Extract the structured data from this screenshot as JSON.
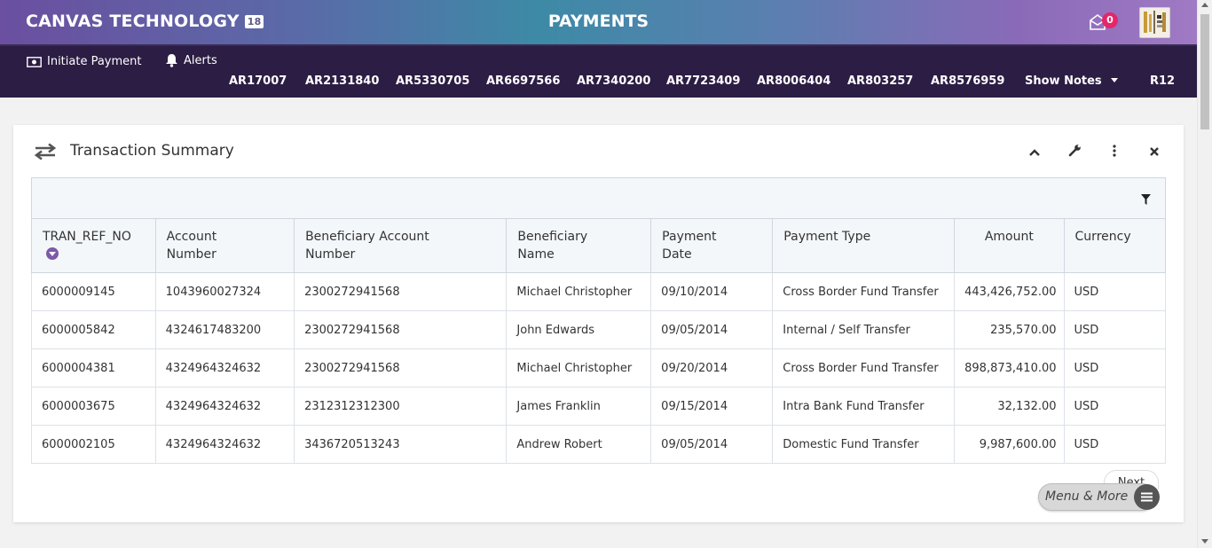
{
  "header": {
    "brand": "CANVAS TECHNOLOGY",
    "brand_badge": "18",
    "page_title": "PAYMENTS",
    "mail_count": "0"
  },
  "nav": {
    "initiate_payment": "Initiate Payment",
    "alerts": "Alerts",
    "links": [
      "AR17007",
      "AR2131840",
      "AR5330705",
      "AR6697566",
      "AR7340200",
      "AR7723409",
      "AR8006404",
      "AR803257",
      "AR8576959"
    ],
    "show_notes": "Show Notes",
    "r12": "R12"
  },
  "card": {
    "title": "Transaction Summary",
    "columns": [
      "TRAN_REF_NO",
      "Account Number",
      "Beneficiary Account Number",
      "Beneficiary Name",
      "Payment Date",
      "Payment Type",
      "Amount",
      "Currency"
    ],
    "rows": [
      [
        "6000009145",
        "1043960027324",
        "2300272941568",
        "Michael Christopher",
        "09/10/2014",
        "Cross Border Fund Transfer",
        "443,426,752.00",
        "USD"
      ],
      [
        "6000005842",
        "4324617483200",
        "2300272941568",
        "John Edwards",
        "09/05/2014",
        "Internal / Self Transfer",
        "235,570.00",
        "USD"
      ],
      [
        "6000004381",
        "4324964324632",
        "2300272941568",
        "Michael Christopher",
        "09/20/2014",
        "Cross Border Fund Transfer",
        "898,873,410.00",
        "USD"
      ],
      [
        "6000003675",
        "4324964324632",
        "2312312312300",
        "James Franklin",
        "09/15/2014",
        "Intra Bank Fund Transfer",
        "32,132.00",
        "USD"
      ],
      [
        "6000002105",
        "4324964324632",
        "3436720513243",
        "Andrew Robert",
        "09/05/2014",
        "Domestic Fund Transfer",
        "9,987,600.00",
        "USD"
      ]
    ],
    "next_label": "Next"
  },
  "menu_more": "Menu & More",
  "colors": {
    "nav_bg": "#2c1d44",
    "accent": "#7b5aa6",
    "badge": "#e5266a"
  }
}
